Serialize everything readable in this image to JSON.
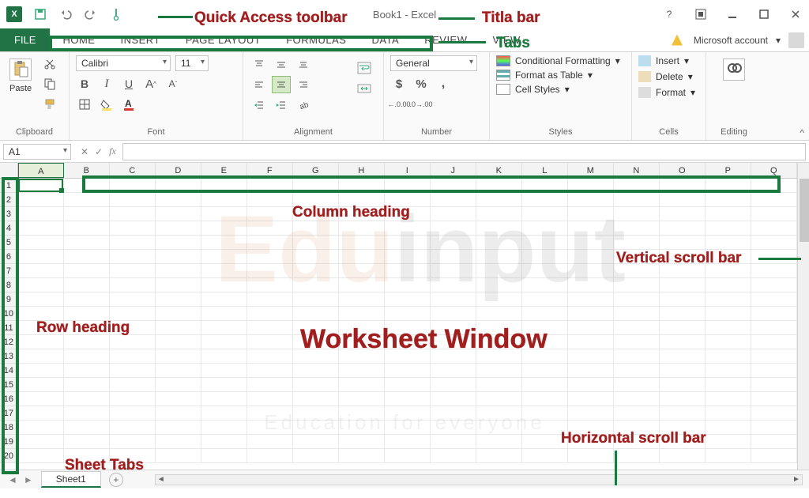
{
  "titlebar": {
    "app_logo": "X",
    "title": "Book1 - Excel"
  },
  "tabs": {
    "file": "FILE",
    "items": [
      "HOME",
      "INSERT",
      "PAGE LAYOUT",
      "FORMULAS",
      "DATA",
      "REVIEW",
      "VIEW"
    ],
    "account": "Microsoft account"
  },
  "account_dropdown_glyph": "▾",
  "ribbon": {
    "clipboard": {
      "label": "Clipboard",
      "paste": "Paste"
    },
    "font": {
      "label": "Font",
      "name": "Calibri",
      "size": "11",
      "bold": "B",
      "italic": "I",
      "underline": "U",
      "grow": "A",
      "shrink": "A"
    },
    "alignment": {
      "label": "Alignment"
    },
    "number": {
      "label": "Number",
      "format": "General",
      "currency": "$",
      "percent": "%",
      "comma": ",",
      "inc": ".00",
      "dec": ".00"
    },
    "styles": {
      "label": "Styles",
      "cf": "Conditional Formatting",
      "fat": "Format as Table",
      "cs": "Cell Styles"
    },
    "cells": {
      "label": "Cells",
      "insert": "Insert",
      "delete": "Delete",
      "format": "Format"
    },
    "editing": {
      "label": "Editing"
    }
  },
  "formula": {
    "namebox": "A1",
    "fx": "fx",
    "cancel": "✕",
    "enter": "✓"
  },
  "columns": [
    "A",
    "B",
    "C",
    "D",
    "E",
    "F",
    "G",
    "H",
    "I",
    "J",
    "K",
    "L",
    "M",
    "N",
    "O",
    "P",
    "Q"
  ],
  "rows": [
    "1",
    "2",
    "3",
    "4",
    "5",
    "6",
    "7",
    "8",
    "9",
    "10",
    "11",
    "12",
    "13",
    "14",
    "15",
    "16",
    "17",
    "18",
    "19",
    "20"
  ],
  "sheet": {
    "name": "Sheet1",
    "add": "+"
  },
  "annotations": {
    "qat": "Quick Access toolbar",
    "titlebar": "Titla bar",
    "tabs": "Tabs",
    "colhead": "Column heading",
    "rowhead": "Row heading",
    "ws": "Worksheet Window",
    "vscroll": "Vertical scroll bar",
    "hscroll": "Horizontal scroll bar",
    "sheettabs": "Sheet Tabs"
  },
  "watermark": {
    "brand_a": "Edu",
    "brand_b": "input",
    "sub": "Education for everyone"
  }
}
